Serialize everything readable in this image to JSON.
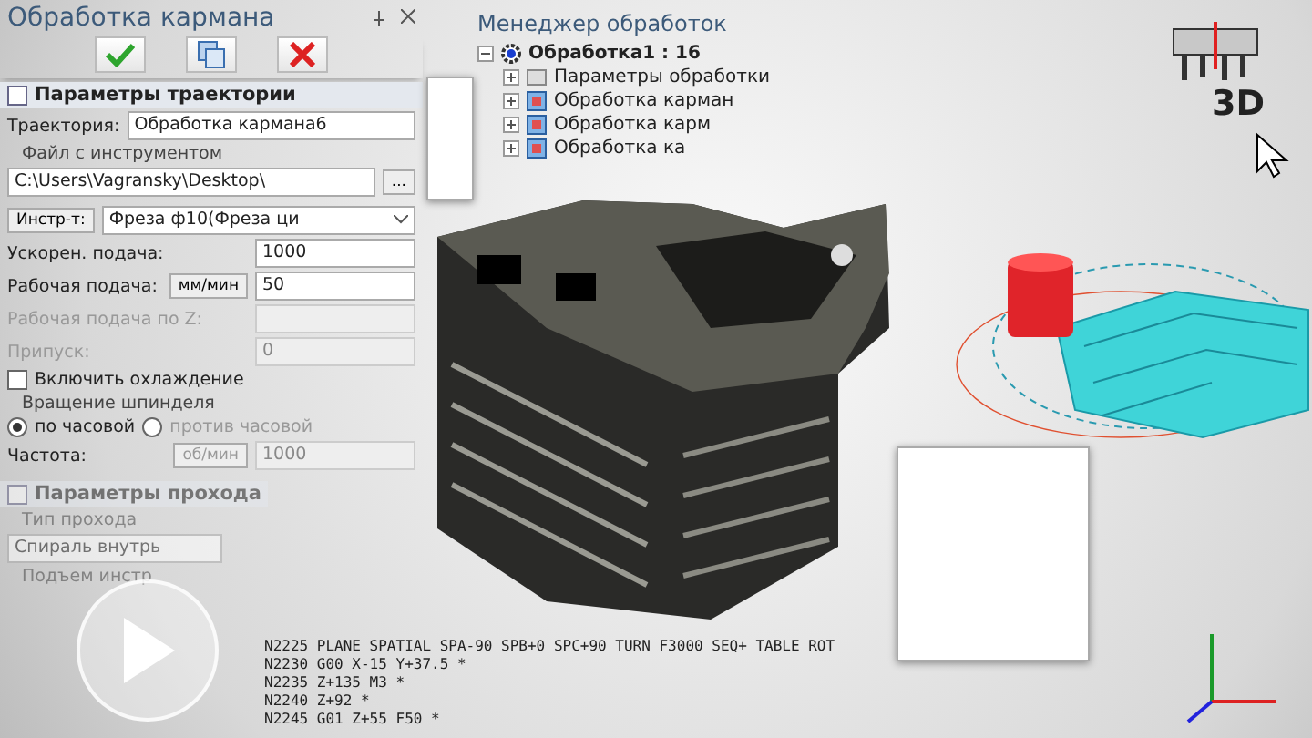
{
  "panel": {
    "title": "Обработка кармана",
    "toolbar": [
      {
        "kind": "ok"
      },
      {
        "kind": "copy"
      },
      {
        "kind": "cancel"
      }
    ],
    "section": "Параметры траектории",
    "trajectory": {
      "label": "Траектория:",
      "value": "Обработка кармана6"
    },
    "tool_file": {
      "legend": "Файл с инструментом",
      "value": "C:\\Users\\Vagransky\\Desktop\\",
      "button": "..."
    },
    "tool": {
      "button": "Инстр-т:",
      "value": "Фреза ф10(Фреза ци"
    },
    "fields": [
      {
        "label": "Ускорен. подача:",
        "value": "1000",
        "disabled": false
      },
      {
        "label": "Рабочая подача:",
        "unit": "мм/мин",
        "value": "50",
        "disabled": false
      },
      {
        "label": "Рабочая подача по Z:",
        "disabled": true
      },
      {
        "label": "Припуск:",
        "value": "0",
        "disabled": true
      }
    ],
    "coolant": {
      "label": "Включить охлаждение",
      "checked": false
    },
    "spindle": {
      "legend": "Вращение шпинделя",
      "options": [
        {
          "label": "по часовой",
          "selected": true
        },
        {
          "label": "против часовой",
          "selected": false
        }
      ]
    },
    "frequency": {
      "label": "Частота:",
      "unit": "об/мин",
      "value": "1000",
      "disabled": true
    },
    "section2": "Параметры прохода",
    "pass_type": {
      "legend": "Тип прохода",
      "value": "Спираль внутрь"
    },
    "lift_legend": "Подъем инстр"
  },
  "tree": {
    "title": "Менеджер обработок",
    "root": {
      "label": "Обработка1 : 16",
      "expanded": true,
      "children": [
        {
          "label": "Параметры обработки",
          "kind": "params"
        },
        {
          "label": "Обработка карман",
          "kind": "pocket"
        },
        {
          "label": "Обработка карм",
          "kind": "pocket"
        },
        {
          "label": "Обработка ка",
          "kind": "pocket"
        }
      ]
    }
  },
  "logo": {
    "text": "3D"
  },
  "gcode": [
    "N2225 PLANE SPATIAL SPA-90 SPB+0 SPC+90 TURN F3000 SEQ+ TABLE ROT",
    "N2230 G00 X-15 Y+37.5 *",
    "N2235 Z+135 M3 *",
    "N2240 Z+92 *",
    "N2245 G01 Z+55 F50 *"
  ]
}
